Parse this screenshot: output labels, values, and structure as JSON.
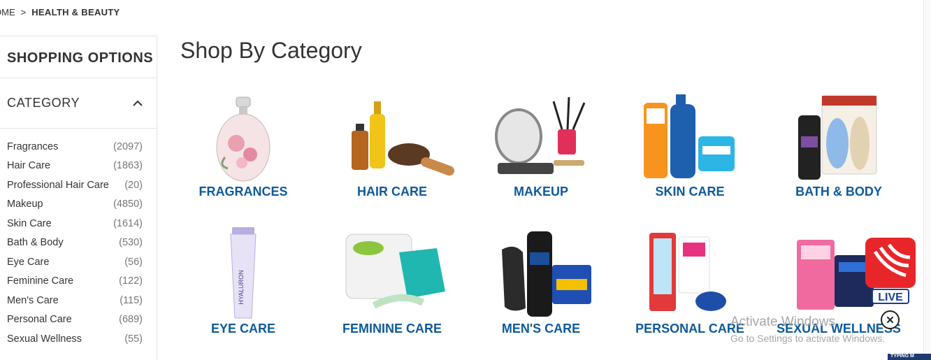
{
  "breadcrumb": {
    "home": "OME",
    "separator": ">",
    "current": "HEALTH & BEAUTY"
  },
  "sidebar": {
    "shopping_options": "SHOPPING OPTIONS",
    "category_title": "CATEGORY",
    "categories": [
      {
        "label": "Fragrances",
        "count": "(2097)"
      },
      {
        "label": "Hair Care",
        "count": "(1863)"
      },
      {
        "label": "Professional Hair Care",
        "count": "(20)"
      },
      {
        "label": "Makeup",
        "count": "(4850)"
      },
      {
        "label": "Skin Care",
        "count": "(1614)"
      },
      {
        "label": "Bath & Body",
        "count": "(530)"
      },
      {
        "label": "Eye Care",
        "count": "(56)"
      },
      {
        "label": "Feminine Care",
        "count": "(122)"
      },
      {
        "label": "Men's Care",
        "count": "(115)"
      },
      {
        "label": "Personal Care",
        "count": "(689)"
      },
      {
        "label": "Sexual Wellness",
        "count": "(55)"
      }
    ]
  },
  "main": {
    "title": "Shop By Category",
    "tiles": [
      {
        "label": "FRAGRANCES",
        "icon": "perfume-bottle-image"
      },
      {
        "label": "HAIR CARE",
        "icon": "hair-oil-brush-image"
      },
      {
        "label": "MAKEUP",
        "icon": "mirror-brushes-image"
      },
      {
        "label": "SKIN CARE",
        "icon": "skincare-bottles-image"
      },
      {
        "label": "BATH & BODY",
        "icon": "shower-gel-loofah-image"
      },
      {
        "label": "EYE CARE",
        "icon": "eye-cream-tube-image"
      },
      {
        "label": "FEMININE CARE",
        "icon": "pads-wipes-image"
      },
      {
        "label": "MEN'S CARE",
        "icon": "shaver-razors-image"
      },
      {
        "label": "PERSONAL CARE",
        "icon": "toothbrush-veet-image"
      },
      {
        "label": "SEXUAL WELLNESS",
        "icon": "durex-box-image"
      }
    ]
  },
  "overlay": {
    "watermark_title": "Activate Windows",
    "watermark_sub": "Go to Settings to activate Windows.",
    "live_label": "LIVE",
    "close_symbol": "✕",
    "bottom_tag": "TYPING M",
    "brand_red": "#e8262a",
    "link_blue": "#0e5a9c"
  }
}
